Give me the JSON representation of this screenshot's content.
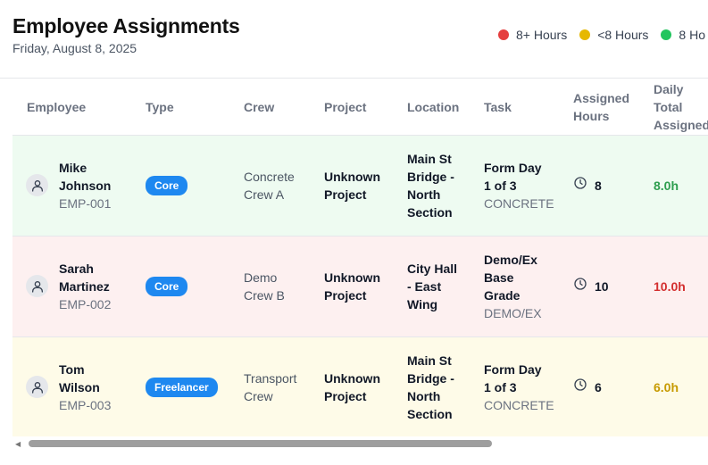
{
  "header": {
    "title": "Employee Assignments",
    "date": "Friday, August 8, 2025"
  },
  "legend": [
    {
      "label": "8+ Hours",
      "color": "#e53e3e"
    },
    {
      "label": "<8 Hours",
      "color": "#e6b800"
    },
    {
      "label": "8 Ho",
      "color": "#22c55e"
    }
  ],
  "table": {
    "columns": [
      "Employee",
      "Type",
      "Crew",
      "Project",
      "Location",
      "Task",
      "Assigned Hours",
      "Daily Total Assigned"
    ],
    "rows": [
      {
        "name": "Mike Johnson",
        "id": "EMP-001",
        "type": "Core",
        "crew": "Concrete Crew A",
        "project": "Unknown Project",
        "location": "Main St Bridge - North Section",
        "task": "Form Day 1 of 3",
        "task_category": "CONCRETE",
        "assigned_hours": "8",
        "daily_total": "8.0h",
        "total_color": "#2e9e4f"
      },
      {
        "name": "Sarah Martinez",
        "id": "EMP-002",
        "type": "Core",
        "crew": "Demo Crew B",
        "project": "Unknown Project",
        "location": "City Hall - East Wing",
        "task": "Demo/Ex Base Grade",
        "task_category": "DEMO/EX",
        "assigned_hours": "10",
        "daily_total": "10.0h",
        "total_color": "#d32f2f"
      },
      {
        "name": "Tom Wilson",
        "id": "EMP-003",
        "type": "Freelancer",
        "crew": "Transport Crew",
        "project": "Unknown Project",
        "location": "Main St Bridge - North Section",
        "task": "Form Day 1 of 3",
        "task_category": "CONCRETE",
        "assigned_hours": "6",
        "daily_total": "6.0h",
        "total_color": "#c79a00"
      }
    ]
  },
  "icons": {
    "avatar": "user-icon",
    "hours": "clock-icon",
    "scroll_left": "scroll-left-arrow-icon"
  }
}
